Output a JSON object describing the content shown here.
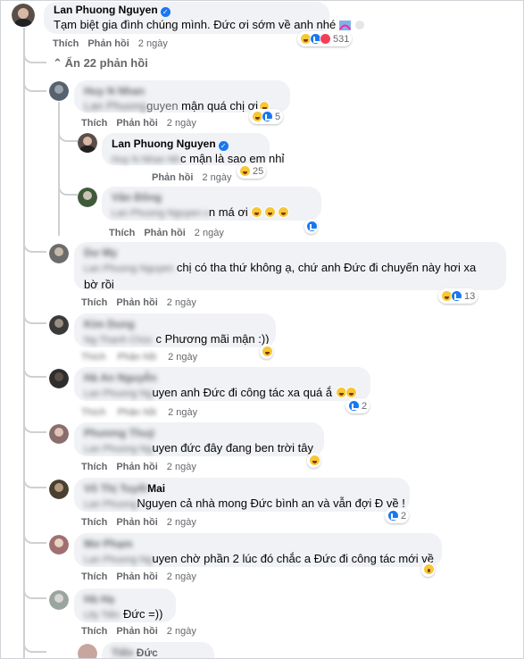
{
  "top_comment": {
    "author": "Lan Phuong Nguyen",
    "text": "Tạm biệt gia đình chúng mình. Đức ơi sớm về anh nhé",
    "actions": {
      "like": "Thích",
      "reply": "Phản hồi",
      "time": "2 ngày"
    },
    "reaction_count": "531"
  },
  "hide_replies_label": "Ẩn 22 phản hồi",
  "replies": [
    {
      "name": "Huy N Nhan",
      "mention": "Lan Phuong Nguyen",
      "mention_visible": "Lan Phuong ",
      "mention_tail": "guyen",
      "text": " mận quá chị ơi",
      "like": "Thích",
      "reply": "Phản hồi",
      "time": "2 ngày",
      "reaction_count": "5"
    },
    {
      "name": "Lan Phuong Nguyen",
      "mention_blur": "Huy N Nhan Nh",
      "text": "c mận là sao em nhỉ",
      "reply": "Phản hồi",
      "time": "2 ngày",
      "reaction_count": "25"
    },
    {
      "name": "Văn Đông",
      "mention_blur": "Lan Phuong Nguyen v",
      "text": "n má ơi",
      "like": "Thích",
      "reply": "Phản hồi",
      "time": "2 ngày"
    },
    {
      "name": "Dư My",
      "mention_blur": "Lan Phuong Nguyen",
      "text": " chị có tha thứ không ạ, chứ anh Đức đi chuyến này hơi xa",
      "text2": "bờ rồi",
      "like": "Thích",
      "reply": "Phản hồi",
      "time": "2 ngày",
      "reaction_count": "13"
    },
    {
      "name": "Kim Dung",
      "mention_blur": "Ng Thanh Chúc",
      "text": " c Phương mãi mận :))",
      "time": "2 ngày"
    },
    {
      "name": "Hà An Nguyễn",
      "mention_blur": "Lan Phuong Ng",
      "mention_tail": "uyen",
      "text": " anh Đức đi công tác xa quá ắ",
      "time": "2 ngày",
      "reaction_count": "2"
    },
    {
      "name": "Phương Thuý",
      "mention_blur": "Lan Phuong Ng",
      "mention_tail": "uyen",
      "text": " đức đây đang ben trời tây",
      "like": "Thích",
      "reply": "Phản hồi",
      "time": "2 ngày"
    },
    {
      "name_blur": "Võ Thị Tuyết ",
      "name_tail": "Mai",
      "mention_blur": "Lan Phuong ",
      "mention_tail": "Nguyen",
      "text": " cả nhà mong Đức bình an và vẫn đợi Đ về !",
      "like": "Thích",
      "reply": "Phản hồi",
      "time": "2 ngày",
      "reaction_count": "2"
    },
    {
      "name": "Mơ Phạm",
      "mention_blur": "Lan Phuong Ng",
      "mention_tail": "uyen",
      "text": " chờ phần 2 lúc đó chắc a Đức đi công tác mới về",
      "like": "Thích",
      "reply": "Phản hồi",
      "time": "2 ngày"
    },
    {
      "name": "Hà Hạ",
      "mention_blur": "Lily Tiến",
      "mention_tail": " Đức",
      "text": " =))",
      "like": "Thích",
      "reply": "Phản hồi",
      "time": "2 ngày"
    },
    {
      "name_blur": "Tiến",
      "name_tail": " Đức"
    }
  ],
  "colors": {
    "link_gray": "#65676b",
    "bubble": "#f0f2f5",
    "like_blue": "#1877f2",
    "haha_yellow": "#f7c737",
    "love_red": "#f33e58"
  }
}
